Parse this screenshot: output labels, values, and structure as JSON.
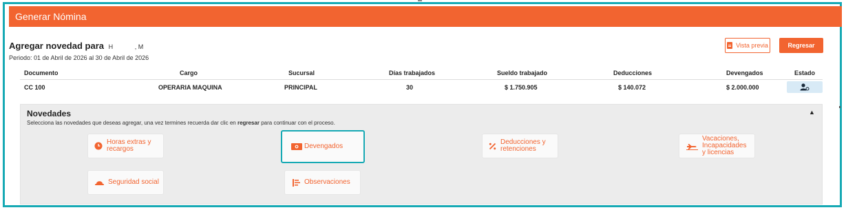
{
  "header": {
    "title": "Generar Nómina"
  },
  "employee": {
    "heading_prefix": "Agregar novedad para",
    "name_first": "H",
    "name_last": ", M",
    "period": "Periodo: 01 de Abril de 2026 al 30 de Abril de 2026"
  },
  "actions": {
    "preview_label": "Vista previa",
    "back_label": "Regresar"
  },
  "table": {
    "headers": [
      "Documento",
      "Cargo",
      "Sucursal",
      "Días trabajados",
      "Sueldo trabajado",
      "Deducciones",
      "Devengados",
      "Estado"
    ],
    "row": {
      "documento": "CC 100",
      "cargo": "OPERARIA MAQUINA",
      "sucursal": "PRINCIPAL",
      "dias": "30",
      "sueldo": "$ 1.750.905",
      "deducciones": "$ 140.072",
      "devengados": "$ 2.000.000",
      "estado_icon": "user-clock-icon"
    }
  },
  "novedades": {
    "title": "Novedades",
    "desc_before": "Selecciona las novedades que deseas agregar, una vez termines recuerda dar clic en ",
    "desc_bold": "regresar",
    "desc_after": " para continuar con el proceso.",
    "options": [
      {
        "label": "Horas extras y recargos",
        "icon": "clock-icon",
        "selected": false
      },
      {
        "label": "Devengados",
        "icon": "money-icon",
        "selected": true
      },
      {
        "label": "Deducciones y retenciones",
        "icon": "percent-icon",
        "selected": false
      },
      {
        "label": "Vacaciones, Incapacidades y licencias",
        "icon": "plane-icon",
        "selected": false
      },
      {
        "label": "Seguridad social",
        "icon": "hardhat-icon",
        "selected": false
      },
      {
        "label": "Observaciones",
        "icon": "list-icon",
        "selected": false
      }
    ]
  },
  "colors": {
    "accent": "#f26430",
    "selection": "#16a9b4",
    "status_bg": "#d8eaf6"
  }
}
